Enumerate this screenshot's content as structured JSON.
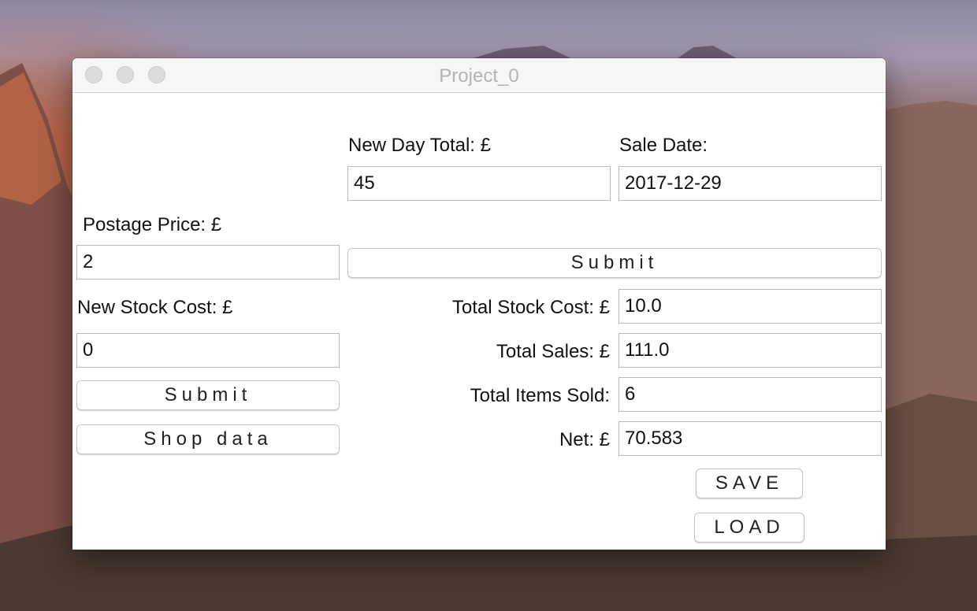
{
  "window": {
    "title": "Project_0"
  },
  "day_section": {
    "day_total_label": "New Day Total: £",
    "day_total_value": "45",
    "sale_date_label": "Sale Date:",
    "sale_date_value": "2017-12-29",
    "submit_label": "Submit"
  },
  "postage": {
    "label": "Postage Price: £",
    "value": "2"
  },
  "stock": {
    "label": "New Stock Cost: £",
    "value": "0",
    "submit_label": "Submit",
    "shop_data_label": "Shop data"
  },
  "totals": {
    "total_stock_cost_label": "Total Stock Cost: £",
    "total_stock_cost_value": "10.0",
    "total_sales_label": "Total Sales: £",
    "total_sales_value": "111.0",
    "total_items_sold_label": "Total Items Sold:",
    "total_items_sold_value": "6",
    "net_label": "Net: £",
    "net_value": "70.583"
  },
  "actions": {
    "save_label": "SAVE",
    "load_label": "LOAD"
  }
}
